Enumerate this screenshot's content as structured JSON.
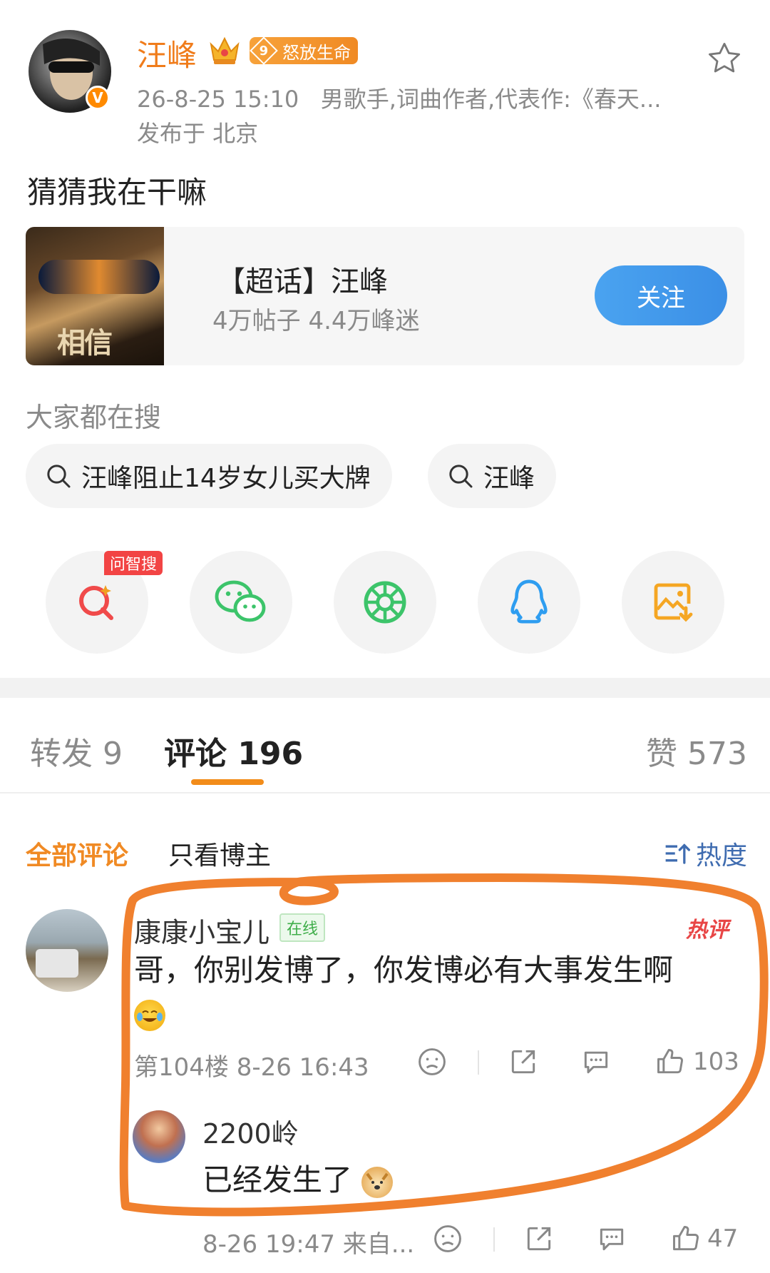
{
  "author": {
    "name": "汪峰",
    "vip_level": "9",
    "vip_label": "怒放生命",
    "timestamp": "26-8-25 15:10",
    "bio": "男歌手,词曲作者,代表作:《春天...",
    "location": "发布于 北京"
  },
  "post": {
    "text": "猜猜我在干嘛"
  },
  "supertopic": {
    "title": "【超话】汪峰",
    "stats": "4万帖子 4.4万峰迷",
    "follow_label": "关注",
    "poster_text": "相信"
  },
  "search": {
    "label": "大家都在搜",
    "chips": [
      "汪峰阻止14岁女儿买大牌",
      "汪峰"
    ]
  },
  "share": {
    "ai_tag": "问智搜",
    "icons": [
      "ai-search-icon",
      "wechat-icon",
      "moments-icon",
      "qq-icon",
      "save-image-icon"
    ]
  },
  "tabs": {
    "repost": "转发 9",
    "comments": "评论 196",
    "likes": "赞 573"
  },
  "filters": {
    "all": "全部评论",
    "author_only": "只看博主",
    "sort": "热度"
  },
  "comment": {
    "user": "康康小宝儿",
    "online": "在线",
    "hot": "热评",
    "text": "哥，你别发博了，你发博必有大事发生啊",
    "floor_time": "第104楼 8-26 16:43",
    "likes": "103"
  },
  "reply": {
    "user": "2200岭",
    "text": "已经发生了",
    "time_source": "8-26 19:47 来自...",
    "likes": "47"
  },
  "colors": {
    "brand_orange": "#f08a24",
    "follow_blue": "#3b8fe6",
    "annotation_orange": "#f0802e",
    "online_green": "#3fae4a",
    "hot_red": "#e84646"
  }
}
